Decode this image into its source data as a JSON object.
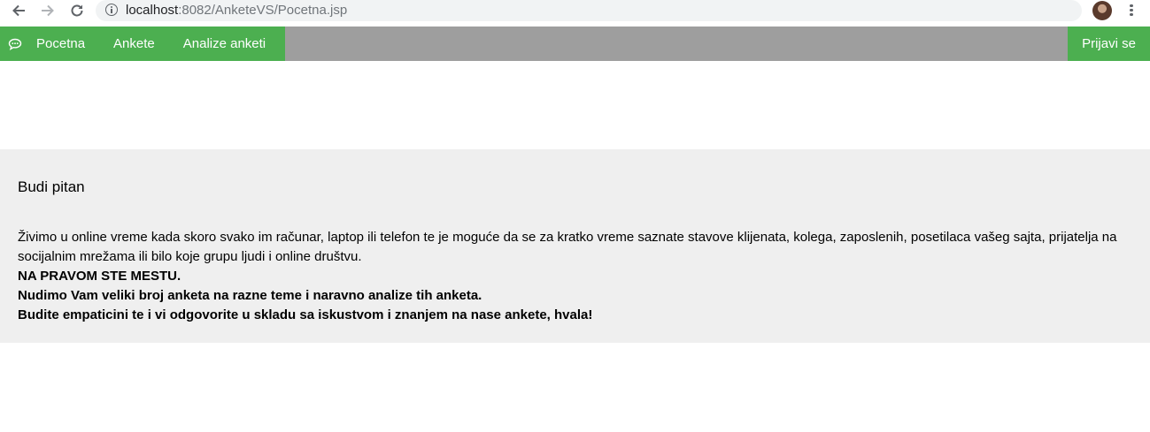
{
  "browser": {
    "url_host": "localhost",
    "url_rest": ":8082/AnketeVS/Pocetna.jsp"
  },
  "nav": {
    "items": [
      "Pocetna",
      "Ankete",
      "Analize anketi"
    ],
    "login_label": "Prijavi se",
    "colors": {
      "green": "#4caf50",
      "bar": "#9e9e9e"
    },
    "icon": "chat-bubble-icon"
  },
  "panel": {
    "title": "Budi pitan",
    "paragraph": "Živimo u online vreme kada skoro svako im računar, laptop ili telefon te je moguće da se za kratko vreme saznate stavove klijenata, kolega, zaposlenih, posetilaca vašeg sajta, prijatelja na socijalnim mrežama ili bilo koje grupu ljudi i online društvu.",
    "bold_lines": [
      "NA PRAVOM STE MESTU.",
      "Nudimo Vam veliki broj anketa na razne teme i naravno analize tih anketa.",
      "Budite empaticini te i vi odgovorite u skladu sa iskustvom i znanjem na nase ankete, hvala!"
    ]
  }
}
